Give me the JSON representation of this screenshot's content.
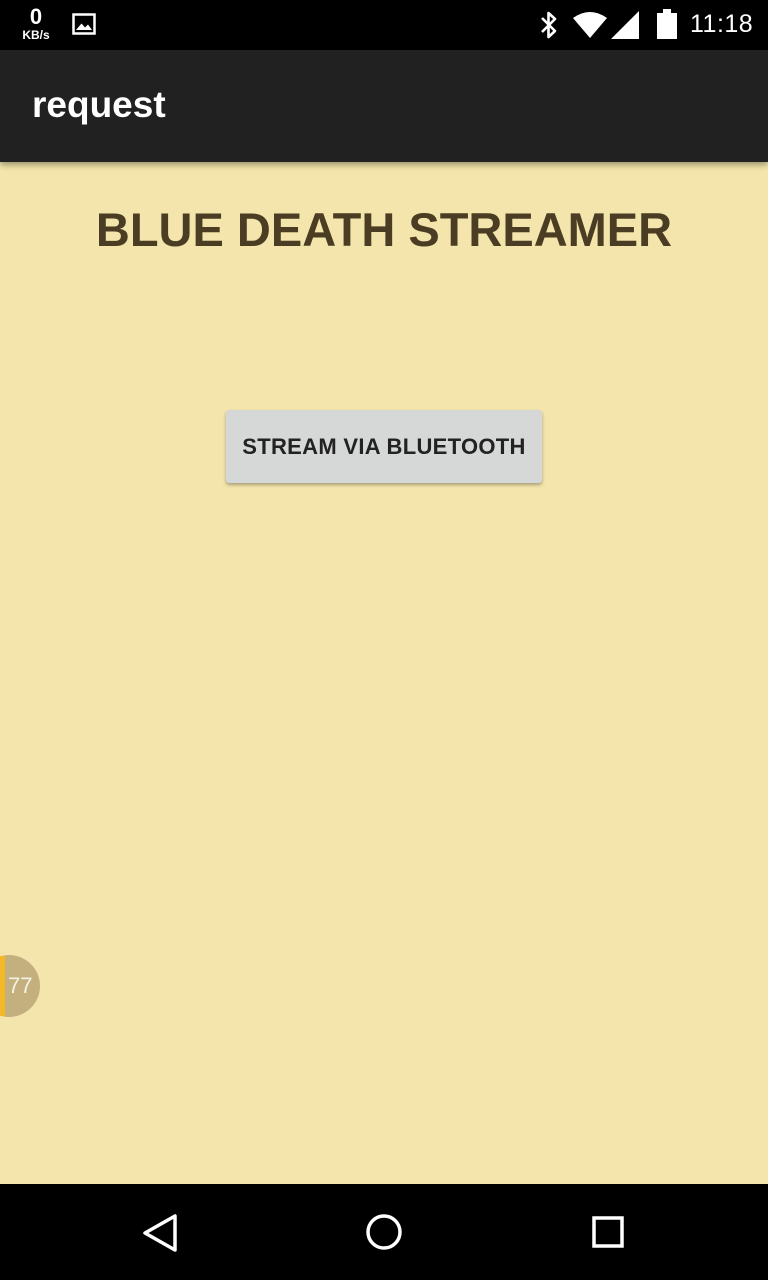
{
  "status_bar": {
    "net_speed_value": "0",
    "net_speed_unit": "KB/s",
    "icons": [
      "image-notification-icon",
      "bluetooth-icon",
      "wifi-icon",
      "cell-signal-icon",
      "battery-icon"
    ],
    "time": "11:18"
  },
  "app_bar": {
    "title": "request"
  },
  "main": {
    "heading": "BLUE DEATH STREAMER",
    "stream_button_label": "STREAM VIA BLUETOOTH"
  },
  "floating_badge": {
    "text": "77"
  },
  "nav_bar": {
    "icons": [
      "back-icon",
      "home-icon",
      "recents-icon"
    ]
  },
  "colors": {
    "background": "#f3e5ab",
    "app_bar": "#212121",
    "heading_text": "#4a3d23",
    "button": "#d6d7d7",
    "badge": "#c3b07e",
    "badge_accent": "#f2b825"
  }
}
